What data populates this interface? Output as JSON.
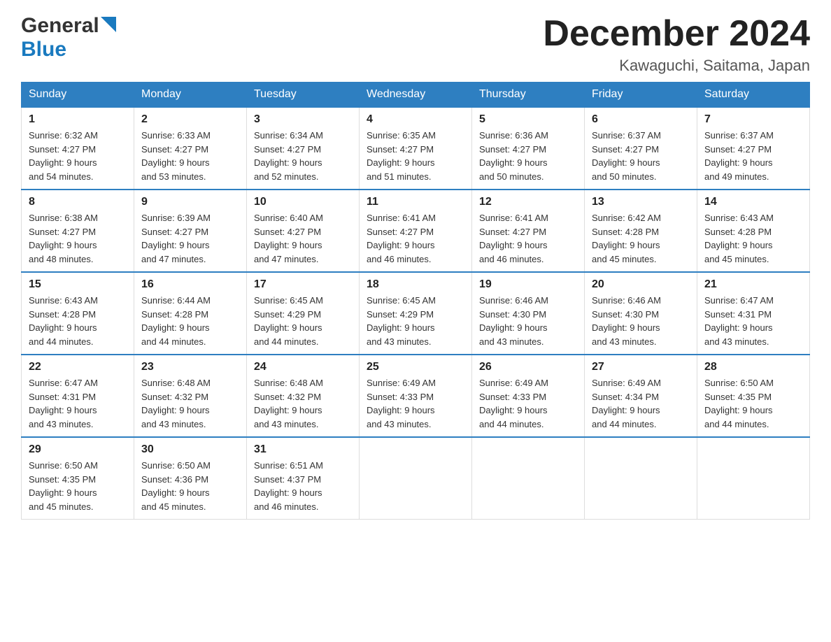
{
  "header": {
    "logo": {
      "general": "General",
      "blue": "Blue"
    },
    "title": "December 2024",
    "location": "Kawaguchi, Saitama, Japan"
  },
  "calendar": {
    "days_of_week": [
      "Sunday",
      "Monday",
      "Tuesday",
      "Wednesday",
      "Thursday",
      "Friday",
      "Saturday"
    ],
    "weeks": [
      [
        {
          "day": 1,
          "sunrise": "6:32 AM",
          "sunset": "4:27 PM",
          "daylight": "9 hours and 54 minutes."
        },
        {
          "day": 2,
          "sunrise": "6:33 AM",
          "sunset": "4:27 PM",
          "daylight": "9 hours and 53 minutes."
        },
        {
          "day": 3,
          "sunrise": "6:34 AM",
          "sunset": "4:27 PM",
          "daylight": "9 hours and 52 minutes."
        },
        {
          "day": 4,
          "sunrise": "6:35 AM",
          "sunset": "4:27 PM",
          "daylight": "9 hours and 51 minutes."
        },
        {
          "day": 5,
          "sunrise": "6:36 AM",
          "sunset": "4:27 PM",
          "daylight": "9 hours and 50 minutes."
        },
        {
          "day": 6,
          "sunrise": "6:37 AM",
          "sunset": "4:27 PM",
          "daylight": "9 hours and 50 minutes."
        },
        {
          "day": 7,
          "sunrise": "6:37 AM",
          "sunset": "4:27 PM",
          "daylight": "9 hours and 49 minutes."
        }
      ],
      [
        {
          "day": 8,
          "sunrise": "6:38 AM",
          "sunset": "4:27 PM",
          "daylight": "9 hours and 48 minutes."
        },
        {
          "day": 9,
          "sunrise": "6:39 AM",
          "sunset": "4:27 PM",
          "daylight": "9 hours and 47 minutes."
        },
        {
          "day": 10,
          "sunrise": "6:40 AM",
          "sunset": "4:27 PM",
          "daylight": "9 hours and 47 minutes."
        },
        {
          "day": 11,
          "sunrise": "6:41 AM",
          "sunset": "4:27 PM",
          "daylight": "9 hours and 46 minutes."
        },
        {
          "day": 12,
          "sunrise": "6:41 AM",
          "sunset": "4:27 PM",
          "daylight": "9 hours and 46 minutes."
        },
        {
          "day": 13,
          "sunrise": "6:42 AM",
          "sunset": "4:28 PM",
          "daylight": "9 hours and 45 minutes."
        },
        {
          "day": 14,
          "sunrise": "6:43 AM",
          "sunset": "4:28 PM",
          "daylight": "9 hours and 45 minutes."
        }
      ],
      [
        {
          "day": 15,
          "sunrise": "6:43 AM",
          "sunset": "4:28 PM",
          "daylight": "9 hours and 44 minutes."
        },
        {
          "day": 16,
          "sunrise": "6:44 AM",
          "sunset": "4:28 PM",
          "daylight": "9 hours and 44 minutes."
        },
        {
          "day": 17,
          "sunrise": "6:45 AM",
          "sunset": "4:29 PM",
          "daylight": "9 hours and 44 minutes."
        },
        {
          "day": 18,
          "sunrise": "6:45 AM",
          "sunset": "4:29 PM",
          "daylight": "9 hours and 43 minutes."
        },
        {
          "day": 19,
          "sunrise": "6:46 AM",
          "sunset": "4:30 PM",
          "daylight": "9 hours and 43 minutes."
        },
        {
          "day": 20,
          "sunrise": "6:46 AM",
          "sunset": "4:30 PM",
          "daylight": "9 hours and 43 minutes."
        },
        {
          "day": 21,
          "sunrise": "6:47 AM",
          "sunset": "4:31 PM",
          "daylight": "9 hours and 43 minutes."
        }
      ],
      [
        {
          "day": 22,
          "sunrise": "6:47 AM",
          "sunset": "4:31 PM",
          "daylight": "9 hours and 43 minutes."
        },
        {
          "day": 23,
          "sunrise": "6:48 AM",
          "sunset": "4:32 PM",
          "daylight": "9 hours and 43 minutes."
        },
        {
          "day": 24,
          "sunrise": "6:48 AM",
          "sunset": "4:32 PM",
          "daylight": "9 hours and 43 minutes."
        },
        {
          "day": 25,
          "sunrise": "6:49 AM",
          "sunset": "4:33 PM",
          "daylight": "9 hours and 43 minutes."
        },
        {
          "day": 26,
          "sunrise": "6:49 AM",
          "sunset": "4:33 PM",
          "daylight": "9 hours and 44 minutes."
        },
        {
          "day": 27,
          "sunrise": "6:49 AM",
          "sunset": "4:34 PM",
          "daylight": "9 hours and 44 minutes."
        },
        {
          "day": 28,
          "sunrise": "6:50 AM",
          "sunset": "4:35 PM",
          "daylight": "9 hours and 44 minutes."
        }
      ],
      [
        {
          "day": 29,
          "sunrise": "6:50 AM",
          "sunset": "4:35 PM",
          "daylight": "9 hours and 45 minutes."
        },
        {
          "day": 30,
          "sunrise": "6:50 AM",
          "sunset": "4:36 PM",
          "daylight": "9 hours and 45 minutes."
        },
        {
          "day": 31,
          "sunrise": "6:51 AM",
          "sunset": "4:37 PM",
          "daylight": "9 hours and 46 minutes."
        },
        null,
        null,
        null,
        null
      ]
    ],
    "labels": {
      "sunrise": "Sunrise:",
      "sunset": "Sunset:",
      "daylight": "Daylight:"
    }
  }
}
